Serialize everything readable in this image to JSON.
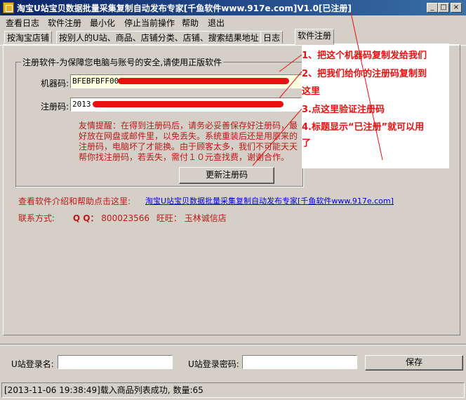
{
  "window": {
    "title": "淘宝U站宝贝数据批量采集复制自动发布专家[千鱼软件www.917e.com]V1.0[已注册]",
    "minimize_glyph": "_",
    "maximize_glyph": "□",
    "close_glyph": "×"
  },
  "menu": [
    "查看日志",
    "软件注册",
    "最小化",
    "停止当前操作",
    "帮助",
    "退出"
  ],
  "tabs": [
    {
      "label": "按淘宝店铺"
    },
    {
      "label": "按别人的U站、商品、店铺分类、店铺、搜索结果地址"
    },
    {
      "label": "日志"
    },
    {
      "label": "软件注册"
    }
  ],
  "register": {
    "group_title": "注册软件-为保障您电脑与账号的安全,请使用正版软件",
    "machine_label": "机器码:",
    "machine_value": "BFEBFBFF000306C3",
    "reg_label": "注册码:",
    "reg_value": "2013",
    "tip": "友情提醒：在得到注册码后，请务必妥善保存好注册码，最好放在网盘或邮件里，以免丢失。系统重装后还是用原来的注册码，电脑坏了才能换。由于顾客太多，我们不可能天天帮你找注册码，若丢失，需付１０元查找费，谢谢合作。",
    "update_button": "更新注册码"
  },
  "help": {
    "label": "查看软件介绍和帮助点击这里:",
    "link": "淘宝U站宝贝数据批量采集复制自动发布专家[千鱼软件www.917e.com]"
  },
  "contact": {
    "label": "联系方式:",
    "qq_label": "Q Q：",
    "qq": "800023566",
    "wangwang_label": "旺旺：",
    "wangwang": "玉林诚信店"
  },
  "annotations": [
    "1、把这个机器码复制发给我们",
    "2、把我们给你的注册码复制到",
    "这里",
    "3.点这里验证注册码",
    "4.标题显示“已注册”就可以用",
    "了"
  ],
  "bottom": {
    "login_label": "U站登录名:",
    "login_value": "",
    "password_label": "U站登录密码:",
    "password_value": "",
    "save_button": "保存"
  },
  "status": "[2013-11-06 19:38:49]载入商品列表成功, 数量:65",
  "colors": {
    "annotation": "#e81010",
    "title_bar": "#0a246a",
    "link": "#0000e0",
    "tip": "#c01818"
  }
}
